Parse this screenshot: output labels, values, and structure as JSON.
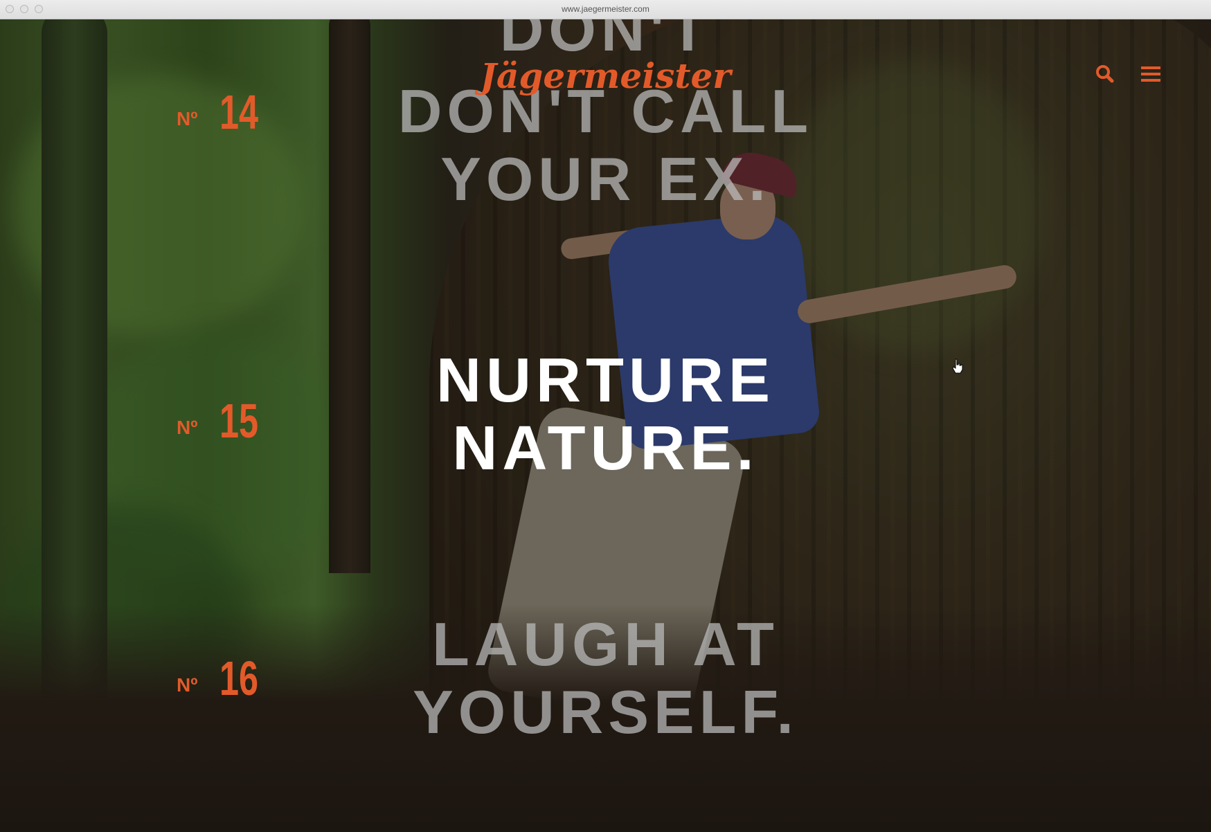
{
  "browser": {
    "url": "www.jaegermeister.com"
  },
  "header": {
    "logo_text": "Jägermeister",
    "search_icon": "search-icon",
    "menu_icon": "hamburger-menu-icon"
  },
  "colors": {
    "accent": "#e35a2a",
    "active_text": "#ffffff",
    "inactive_text": "#bebebe"
  },
  "slogans": {
    "prev_partial": {
      "line1": "DON'T"
    },
    "prev": {
      "number": "14",
      "line1": "DON'T CALL",
      "line2": "YOUR EX."
    },
    "active": {
      "number": "15",
      "line1": "NURTURE",
      "line2": "NATURE."
    },
    "next": {
      "number": "16",
      "line1": "LAUGH AT",
      "line2": "YOURSELF."
    }
  },
  "number_prefix": "Nº"
}
